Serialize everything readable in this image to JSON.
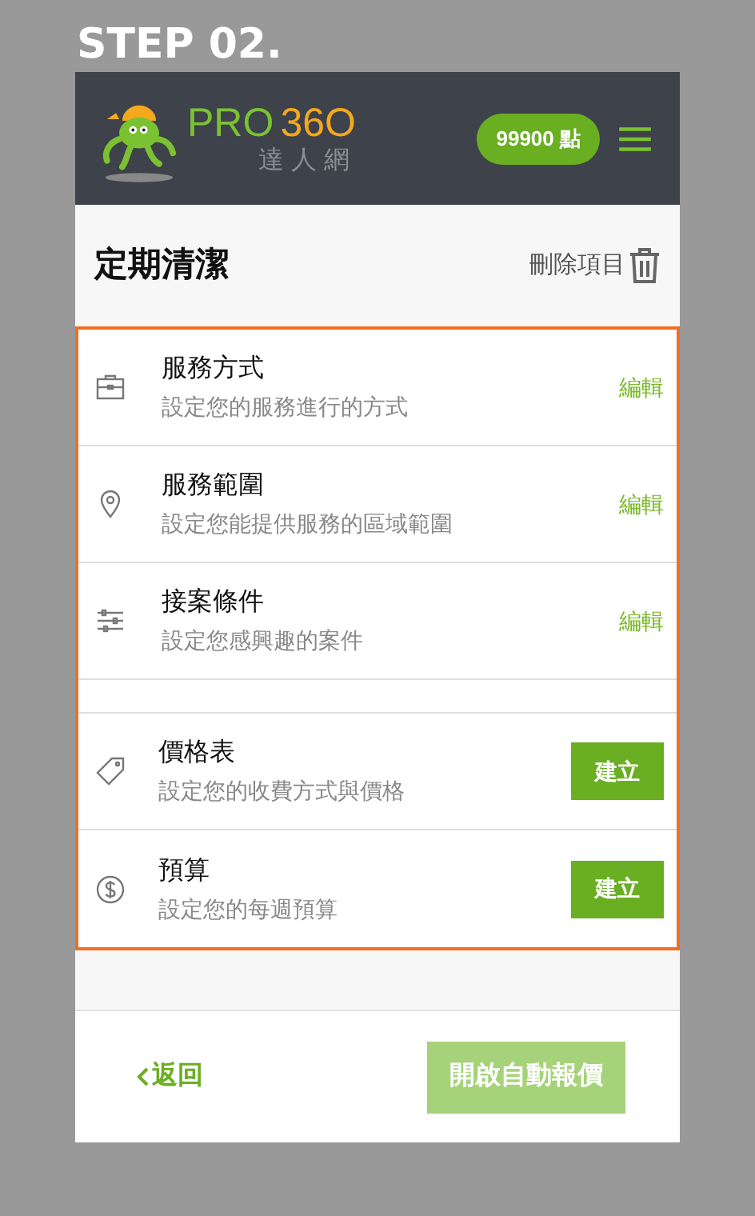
{
  "step_title": "STEP 02.",
  "header": {
    "logo": {
      "brand_left": "PRO",
      "brand_right": "36O",
      "subtitle": "達 人 網"
    },
    "points_badge": "99900 點"
  },
  "page": {
    "title": "定期清潔",
    "delete_label": "刪除項目"
  },
  "setting_groups": [
    {
      "items": [
        {
          "title": "服務方式",
          "description": "設定您的服務進行的方式",
          "kind": "link",
          "action": "編輯"
        },
        {
          "title": "服務範圍",
          "description": "設定您能提供服務的區域範圍",
          "kind": "link",
          "action": "編輯"
        },
        {
          "title": "接案條件",
          "description": "設定您感興趣的案件",
          "kind": "link",
          "action": "編輯"
        }
      ]
    },
    {
      "items": [
        {
          "title": "價格表",
          "description": "設定您的收費方式與價格",
          "kind": "button",
          "action": "建立"
        },
        {
          "title": "預算",
          "description": "設定您的每週預算",
          "kind": "button",
          "action": "建立"
        }
      ]
    }
  ],
  "footer": {
    "back_label": "返回",
    "primary": {
      "label": "開啟自動報價",
      "disabled": true
    }
  }
}
